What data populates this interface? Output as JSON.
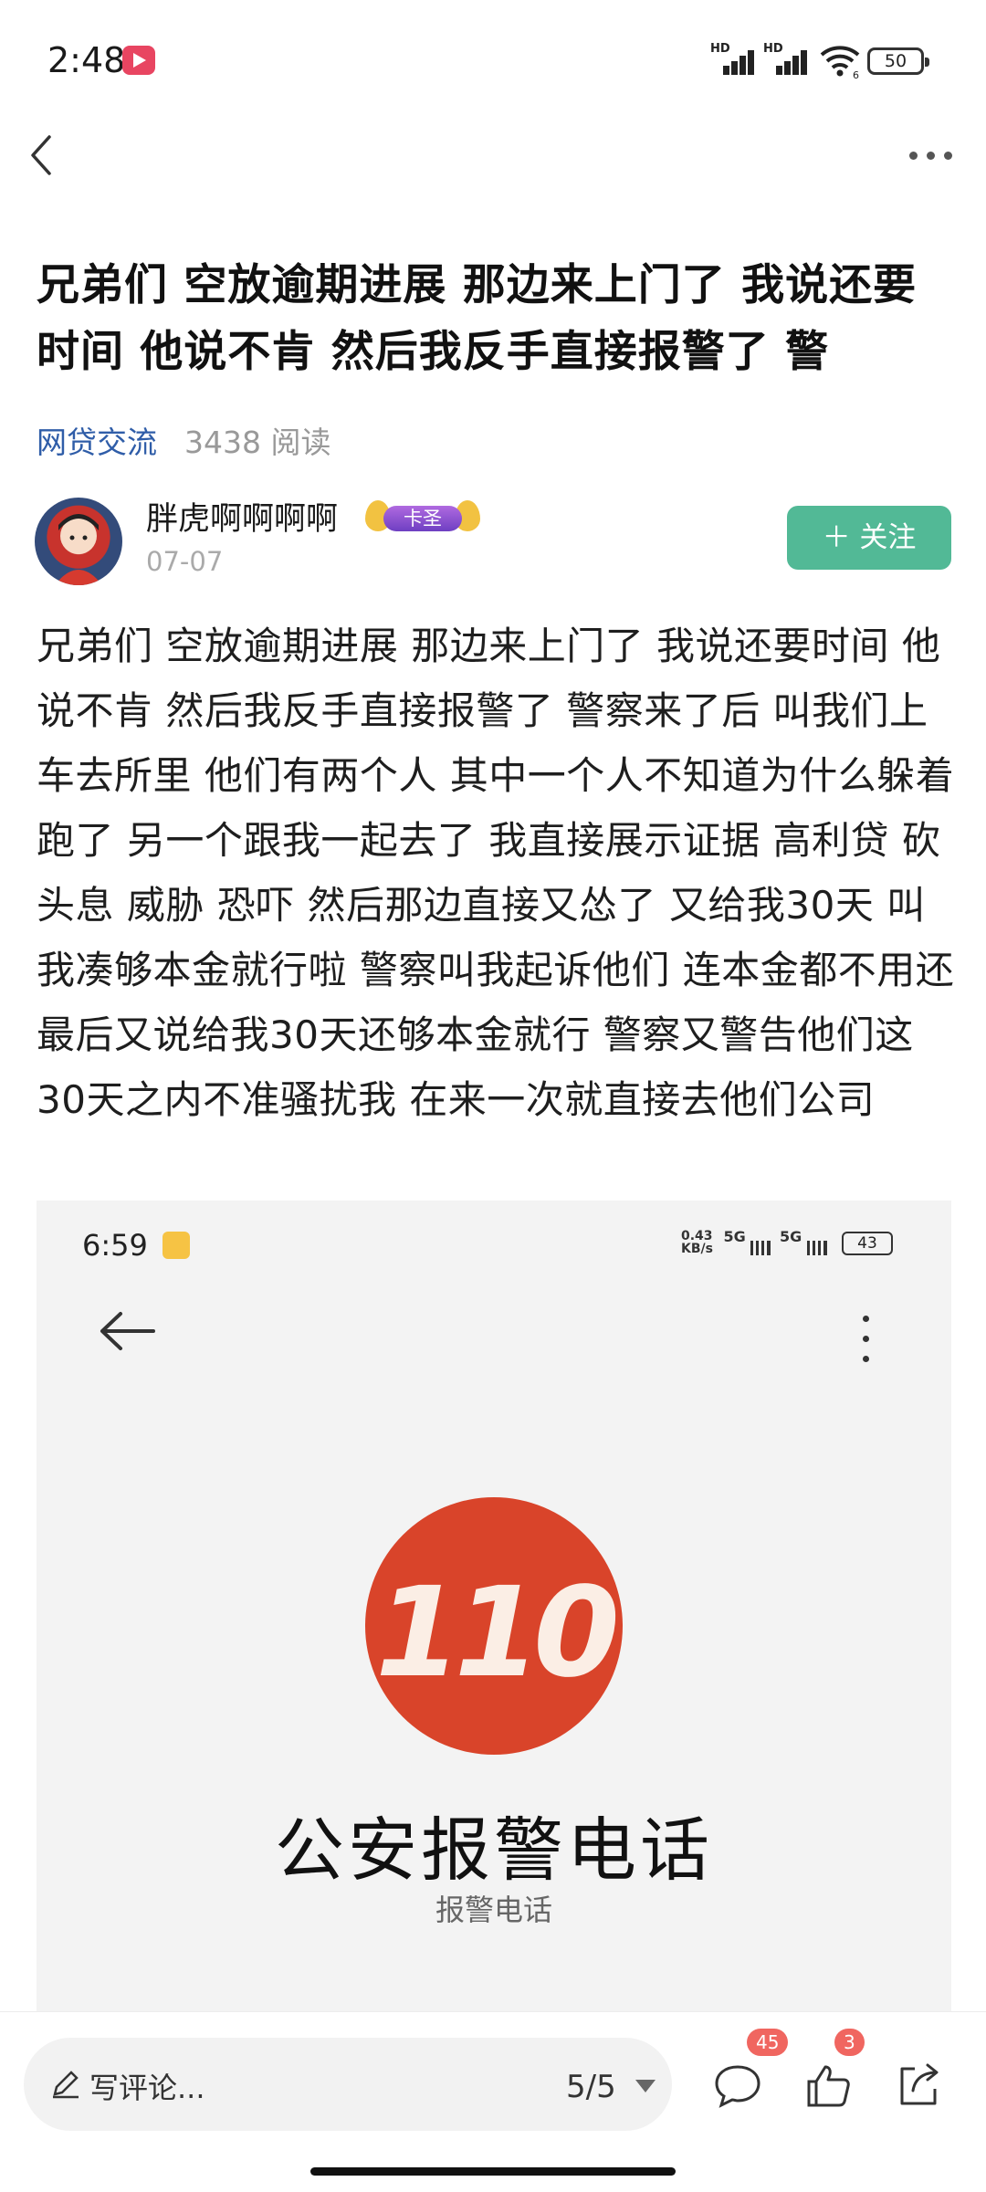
{
  "status_bar": {
    "time": "2:48",
    "signal1_label": "HD",
    "signal2_label": "HD",
    "wifi_label": "6",
    "battery": "50"
  },
  "post": {
    "title": "兄弟们 空放逾期进展 那边来上门了 我说还要时间 他说不肯 然后我反手直接报警了 警",
    "category": "网贷交流",
    "reads": "3438 阅读",
    "author": {
      "name": "胖虎啊啊啊啊",
      "badge": "卡圣",
      "date": "07-07"
    },
    "follow_label": "＋ 关注",
    "body": "兄弟们 空放逾期进展 那边来上门了  我说还要时间 他说不肯 然后我反手直接报警了 警察来了后 叫我们上车去所里 他们有两个人 其中一个人不知道为什么躲着跑了 另一个跟我一起去了 我直接展示证据 高利贷 砍头息 威胁 恐吓  然后那边直接又怂了 又给我30天 叫我凑够本金就行啦 警察叫我起诉他们 连本金都不用还 最后又说给我30天还够本金就行 警察又警告他们这30天之内不准骚扰我 在来一次就直接去他们公司"
  },
  "embedded_screenshot": {
    "time": "6:59",
    "speed": "0.43\nKB/s",
    "net1": "5G",
    "net2": "5G",
    "battery": "43",
    "logo_text": "110",
    "title": "公安报警电话",
    "subtitle": "报警电话"
  },
  "bottom_bar": {
    "comment_placeholder": "写评论...",
    "page_indicator": "5/5",
    "comment_count": "45",
    "like_count": "3"
  }
}
